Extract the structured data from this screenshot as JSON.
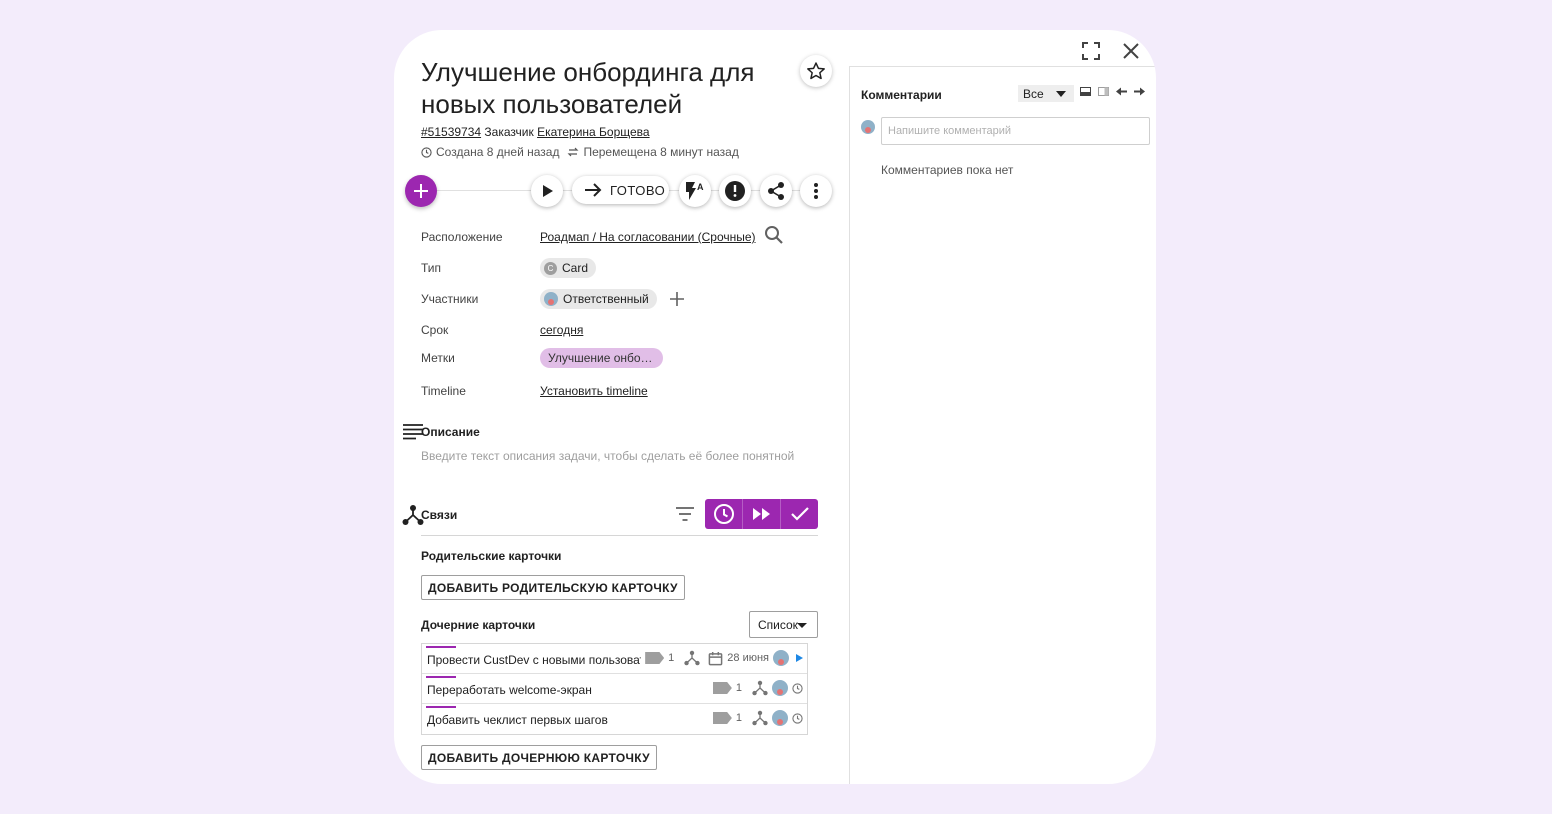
{
  "card": {
    "title": "Улучшение онбординга для новых пользователей",
    "id": "#51539734",
    "customer_label": "Заказчик",
    "customer": "Екатерина Борщева",
    "created": "Создана 8 дней назад",
    "moved": "Перемещена 8 минут назад"
  },
  "toolbar": {
    "done_label": "ГОТОВО"
  },
  "props": {
    "location_label": "Расположение",
    "location_value": "Роадмап / На согласовании (Срочные)",
    "type_label": "Тип",
    "type_value": "Card",
    "type_letter": "C",
    "members_label": "Участники",
    "members_value": "Ответственный",
    "deadline_label": "Срок",
    "deadline_value": "сегодня",
    "tags_label": "Метки",
    "tags_value": "Улучшение онбо…",
    "timeline_label": "Timeline",
    "timeline_value": "Установить timeline"
  },
  "description": {
    "title": "Описание",
    "placeholder": "Введите текст описания задачи, чтобы сделать её более понятной"
  },
  "links": {
    "title": "Связи",
    "parents_title": "Родительские карточки",
    "add_parent": "ДОБАВИТЬ РОДИТЕЛЬСКУЮ КАРТОЧКУ",
    "children_title": "Дочерние карточки",
    "view_select": "Список",
    "add_child": "ДОБАВИТЬ ДОЧЕРНЮЮ КАРТОЧКУ",
    "children": [
      {
        "name": "Провести CustDev с новыми пользователями",
        "tags": "1",
        "date": "28 июня"
      },
      {
        "name": "Переработать welcome-экран",
        "tags": "1"
      },
      {
        "name": "Добавить чеклист первых шагов",
        "tags": "1"
      }
    ]
  },
  "comments": {
    "title": "Комментарии",
    "filter": "Все",
    "placeholder": "Напишите комментарий",
    "empty": "Комментариев пока нет"
  },
  "colors": {
    "accent": "#9c27b0",
    "tag_bg": "#e1bee7",
    "background": "#f3ecfb"
  }
}
